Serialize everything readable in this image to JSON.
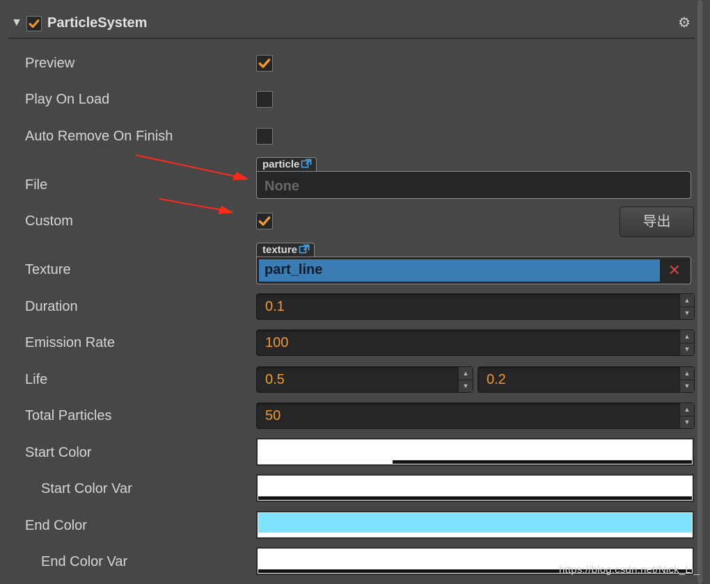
{
  "component": {
    "title": "ParticleSystem",
    "enabled": true
  },
  "rows": {
    "preview": {
      "label": "Preview",
      "checked": true
    },
    "play_on_load": {
      "label": "Play On Load",
      "checked": false
    },
    "auto_remove": {
      "label": "Auto Remove On Finish",
      "checked": false
    },
    "file": {
      "label": "File",
      "asset_type": "particle",
      "value": "None"
    },
    "custom": {
      "label": "Custom",
      "checked": true,
      "button_label": "导出"
    },
    "texture": {
      "label": "Texture",
      "asset_type": "texture",
      "value": "part_line"
    },
    "duration": {
      "label": "Duration",
      "value": "0.1"
    },
    "emission_rate": {
      "label": "Emission Rate",
      "value": "100"
    },
    "life": {
      "label": "Life",
      "value": "0.5",
      "variance": "0.2"
    },
    "total_particles": {
      "label": "Total Particles",
      "value": "50"
    },
    "start_color": {
      "label": "Start Color",
      "color": "#ffffff",
      "alpha": 0.31
    },
    "start_color_var": {
      "label": "Start Color Var",
      "color": "#ffffff",
      "alpha": 0
    },
    "end_color": {
      "label": "End Color",
      "color": "#7fe2ff",
      "alpha": 1
    },
    "end_color_var": {
      "label": "End Color Var",
      "color": "#ffffff",
      "alpha": 0
    }
  },
  "colors": {
    "accent": "#f29a2e",
    "selection": "#3a7db5",
    "remove": "#d04545",
    "annotation": "#ff2a1a"
  },
  "icons": {
    "collapse": "triangle-down-icon",
    "settings": "gear-icon",
    "open_external": "external-link-icon",
    "remove": "close-icon",
    "check": "check-icon"
  },
  "watermark": "https://blog.csdn.net/Nick_Li_"
}
